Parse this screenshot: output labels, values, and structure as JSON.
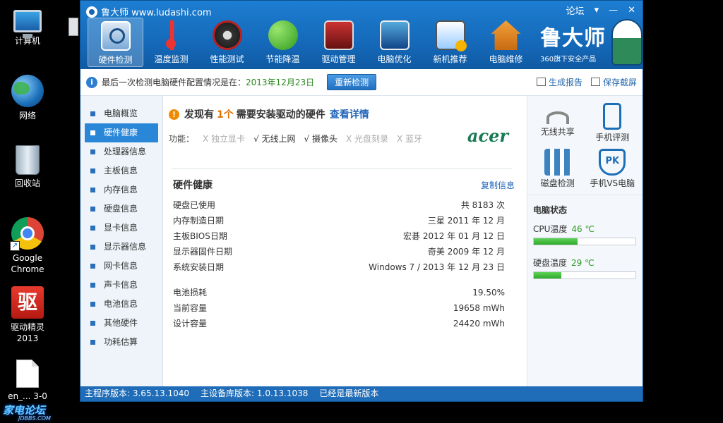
{
  "desktop": {
    "icons": [
      {
        "label": "计算机"
      },
      {
        "label": "网络"
      },
      {
        "label": "回收站"
      },
      {
        "label": "Google Chrome"
      },
      {
        "label": "驱动精灵 2013",
        "glyph": "驱"
      },
      {
        "label": "en_... 3-0"
      }
    ]
  },
  "window": {
    "title": "鲁大师 www.ludashi.com",
    "forum_label": "论坛",
    "min": "—",
    "dropdown": "▾",
    "close": "✕"
  },
  "nav": {
    "items": [
      {
        "label": "硬件检测",
        "active": true
      },
      {
        "label": "温度监测"
      },
      {
        "label": "性能测试"
      },
      {
        "label": "节能降温"
      },
      {
        "label": "驱动管理"
      },
      {
        "label": "电脑优化"
      },
      {
        "label": "新机推荐"
      },
      {
        "label": "电脑维修"
      }
    ]
  },
  "brand": {
    "name": "鲁大师",
    "tagline": "360旗下安全产品"
  },
  "infobar": {
    "text": "最后一次检测电脑硬件配置情况是在：",
    "date": "2013年12月23日",
    "rescan": "重新检测",
    "report": "生成报告",
    "screenshot": "保存截屏"
  },
  "sidebar": {
    "items": [
      {
        "label": "电脑概览"
      },
      {
        "label": "硬件健康",
        "active": true
      },
      {
        "label": "处理器信息"
      },
      {
        "label": "主板信息"
      },
      {
        "label": "内存信息"
      },
      {
        "label": "硬盘信息"
      },
      {
        "label": "显卡信息"
      },
      {
        "label": "显示器信息"
      },
      {
        "label": "网卡信息"
      },
      {
        "label": "声卡信息"
      },
      {
        "label": "电池信息"
      },
      {
        "label": "其他硬件"
      },
      {
        "label": "功耗估算"
      }
    ]
  },
  "main": {
    "alert_prefix": "发现有",
    "alert_count": "1个",
    "alert_suffix": "需要安装驱动的硬件",
    "alert_link": "查看详情",
    "features_label": "功能：",
    "features": [
      {
        "label": "X 独立显卡",
        "on": false
      },
      {
        "label": "√ 无线上网",
        "on": true
      },
      {
        "label": "√ 摄像头",
        "on": true
      },
      {
        "label": "X 光盘刻录",
        "on": false
      },
      {
        "label": "X 蓝牙",
        "on": false
      }
    ],
    "brand_logo": "acer",
    "section_title": "硬件健康",
    "copy_label": "复制信息",
    "rows": [
      {
        "k": "硬盘已使用",
        "v": "共 8183 次"
      },
      {
        "k": "内存制造日期",
        "v": "三星 2011 年 12 月"
      },
      {
        "k": "主板BIOS日期",
        "v": "宏碁 2012 年 01 月 12 日"
      },
      {
        "k": "显示器固件日期",
        "v": "奇美 2009 年 12 月"
      },
      {
        "k": "系统安装日期",
        "v": "Windows 7 / 2013 年 12 月 23 日"
      }
    ],
    "battery_rows": [
      {
        "k": "电池损耗",
        "v": "19.50%"
      },
      {
        "k": "当前容量",
        "v": "19658 mWh"
      },
      {
        "k": "设计容量",
        "v": "24420 mWh"
      }
    ]
  },
  "right": {
    "tools": [
      {
        "label": "无线共享",
        "icon": "wifi-icon"
      },
      {
        "label": "手机评测",
        "icon": "phone-icon"
      },
      {
        "label": "磁盘检测",
        "icon": "disk-icon"
      },
      {
        "label": "手机VS电脑",
        "icon": "pk-icon",
        "glyph": "PK"
      }
    ],
    "status_title": "电脑状态",
    "cpu_label": "CPU温度",
    "cpu_val": "46 ℃",
    "cpu_fill": 0.43,
    "disk_label": "硬盘温度",
    "disk_val": "29 ℃",
    "disk_fill": 0.27
  },
  "statusbar": {
    "main_ver": "主程序版本: 3.65.13.1040",
    "db_ver": "主设备库版本: 1.0.13.1038",
    "latest": "已经是最新版本"
  },
  "watermark": {
    "title": "家电论坛",
    "sub": "JDBBS.COM"
  }
}
